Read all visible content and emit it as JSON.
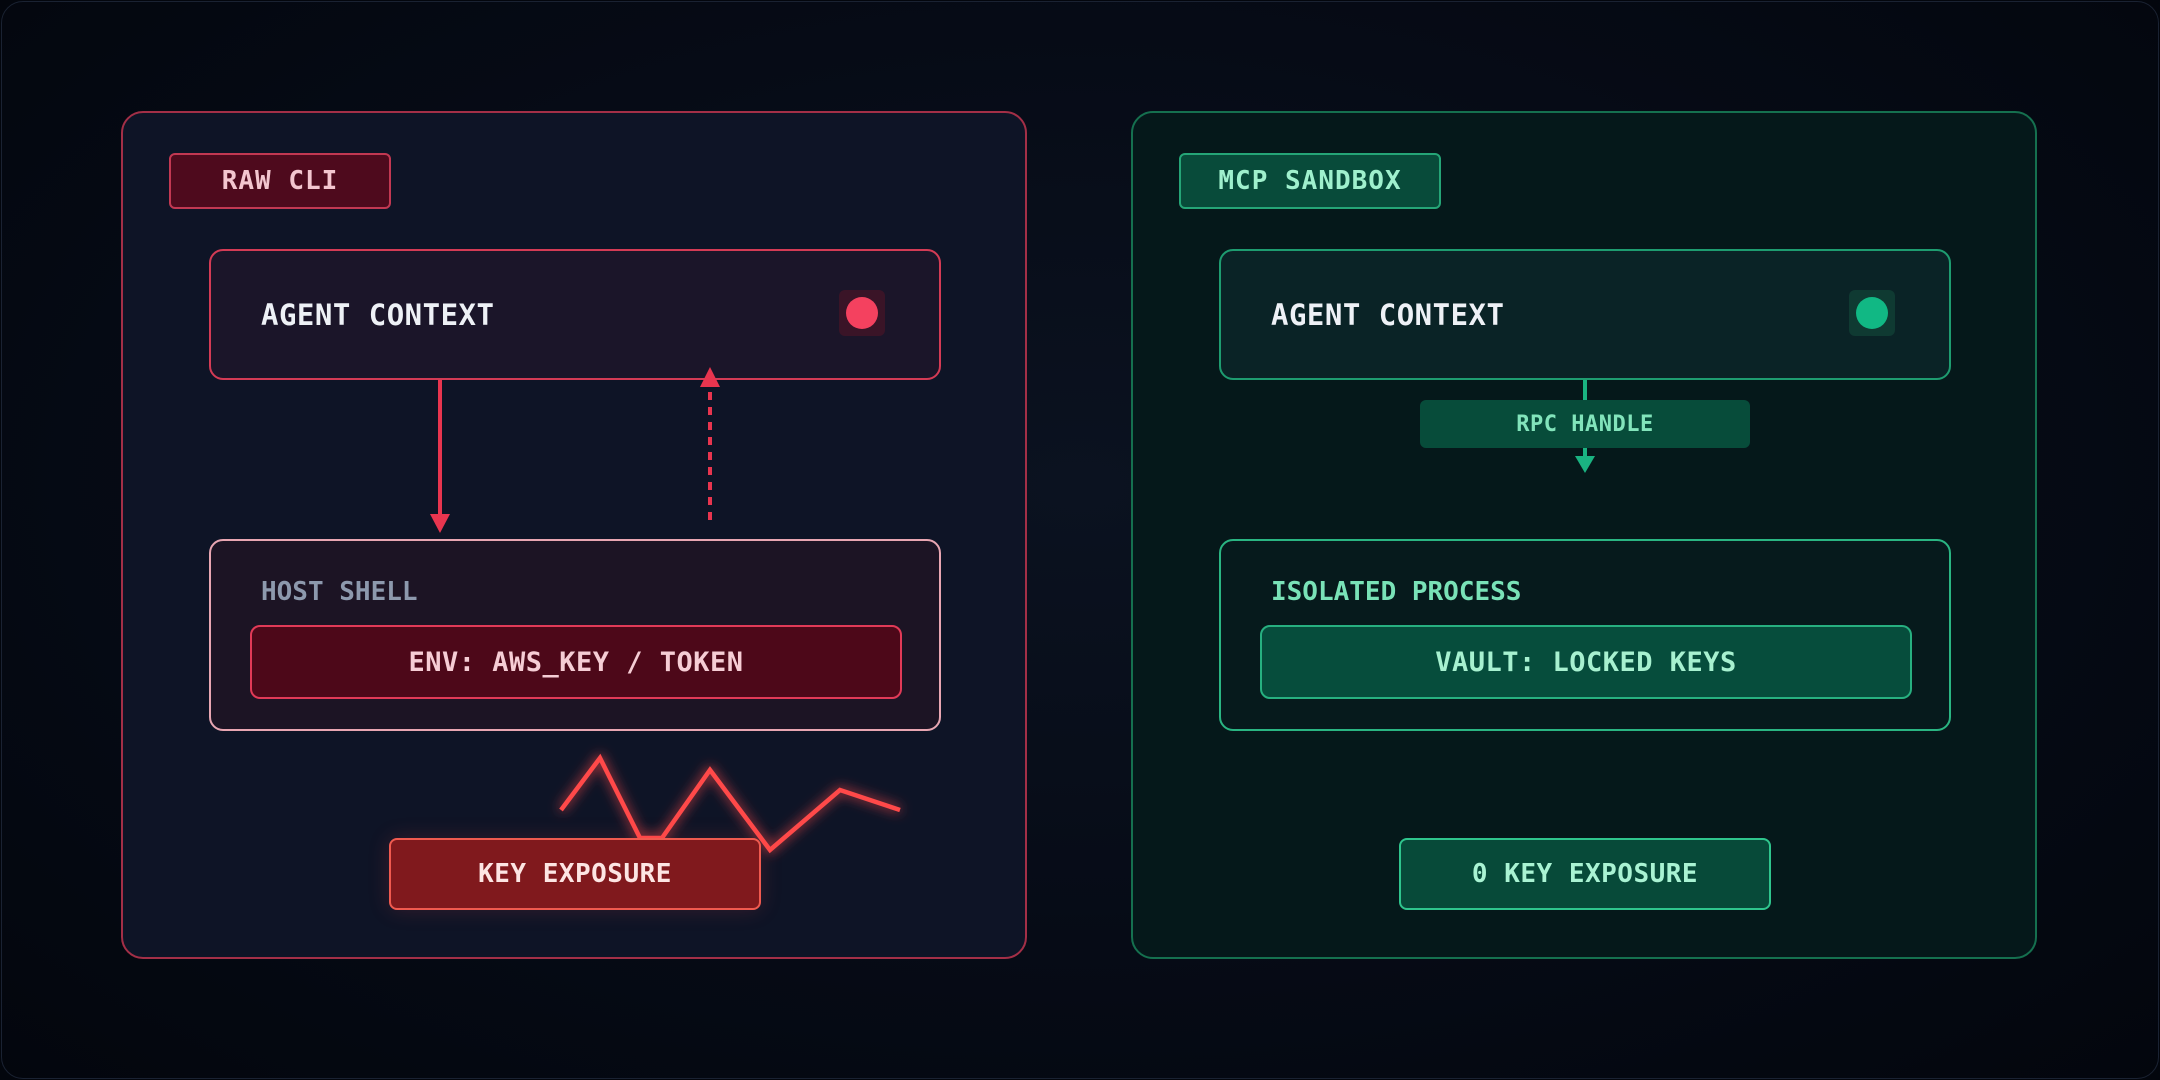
{
  "raw": {
    "tag": "RAW CLI",
    "context": "AGENT CONTEXT",
    "shell_label": "HOST SHELL",
    "env_box": "ENV: AWS_KEY / TOKEN",
    "exposure": "KEY EXPOSURE",
    "color": "#f4415f"
  },
  "mcp": {
    "tag": "MCP SANDBOX",
    "context": "AGENT CONTEXT",
    "handle": "RPC HANDLE",
    "process_label": "ISOLATED PROCESS",
    "vault_box": "VAULT: LOCKED KEYS",
    "exposure": "0 KEY EXPOSURE",
    "color": "#11b884"
  }
}
